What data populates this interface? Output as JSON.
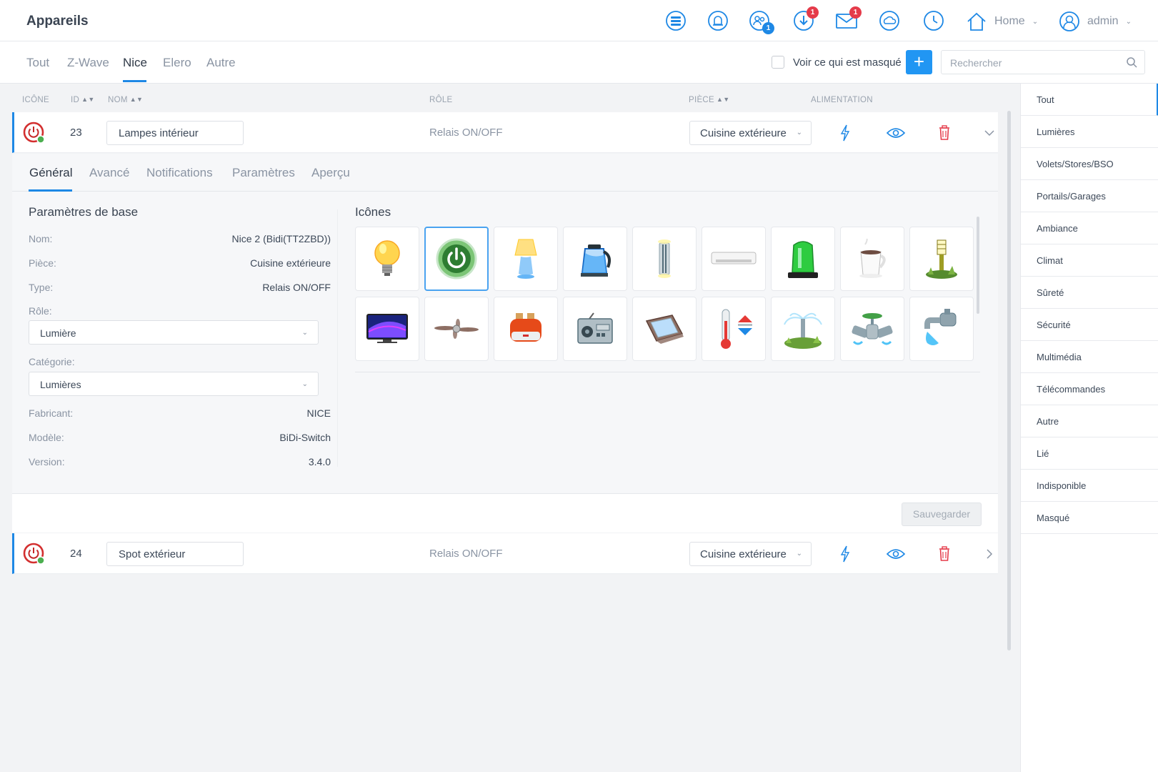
{
  "header": {
    "title": "Appareils",
    "home_label": "Home",
    "user_label": "admin",
    "users_badge": "1",
    "download_badge": "1",
    "mail_badge": "1"
  },
  "filter_tabs": [
    "Tout",
    "Z-Wave",
    "Nice",
    "Elero",
    "Autre"
  ],
  "active_filter": "Nice",
  "show_hidden_label": "Voir ce qui est masqué",
  "add_label": "+",
  "search": {
    "placeholder": "Rechercher",
    "value": ""
  },
  "columns": {
    "icon": "ICÔNE",
    "id": "ID",
    "name": "NOM",
    "role": "RÔLE",
    "room": "PIÈCE",
    "power": "ALIMENTATION"
  },
  "devices": [
    {
      "id": "23",
      "name": "Lampes intérieur",
      "role": "Relais ON/OFF",
      "room": "Cuisine extérieure",
      "expanded": true
    },
    {
      "id": "24",
      "name": "Spot extérieur",
      "role": "Relais ON/OFF",
      "room": "Cuisine extérieure",
      "expanded": false
    }
  ],
  "detail": {
    "tabs": [
      "Général",
      "Avancé",
      "Notifications",
      "Paramètres",
      "Aperçu"
    ],
    "active_tab": "Général",
    "base_title": "Paramètres de base",
    "fields": {
      "name_label": "Nom:",
      "name_value": "Nice 2 (Bidi(TT2ZBD))",
      "room_label": "Pièce:",
      "room_value": "Cuisine extérieure",
      "type_label": "Type:",
      "type_value": "Relais ON/OFF",
      "role_label": "Rôle:",
      "role_value": "Lumière",
      "category_label": "Catégorie:",
      "category_value": "Lumières",
      "maker_label": "Fabricant:",
      "maker_value": "NICE",
      "model_label": "Modèle:",
      "model_value": "BiDi-Switch",
      "version_label": "Version:",
      "version_value": "3.4.0"
    },
    "icons_title": "Icônes",
    "icons": [
      "lightbulb-icon",
      "power-icon",
      "table-lamp-icon",
      "kettle-icon",
      "wall-light-icon",
      "air-conditioner-icon",
      "alarm-beacon-icon",
      "coffee-cup-icon",
      "garden-light-icon",
      "television-icon",
      "ceiling-fan-icon",
      "toaster-icon",
      "radio-icon",
      "roof-window-icon",
      "thermostat-icon",
      "sprinkler-icon",
      "valve-icon",
      "water-tap-icon"
    ],
    "selected_icon": "power-icon",
    "save_label": "Sauvegarder"
  },
  "side_categories": [
    "Tout",
    "Lumières",
    "Volets/Stores/BSO",
    "Portails/Garages",
    "Ambiance",
    "Climat",
    "Sûreté",
    "Sécurité",
    "Multimédia",
    "Télécommandes",
    "Autre",
    "Lié",
    "Indisponible",
    "Masqué"
  ],
  "active_category": "Tout",
  "colors": {
    "accent": "#1e88e5",
    "badge": "#e53b4a",
    "device_icon": "#d32f2f",
    "online": "#4caf50"
  }
}
